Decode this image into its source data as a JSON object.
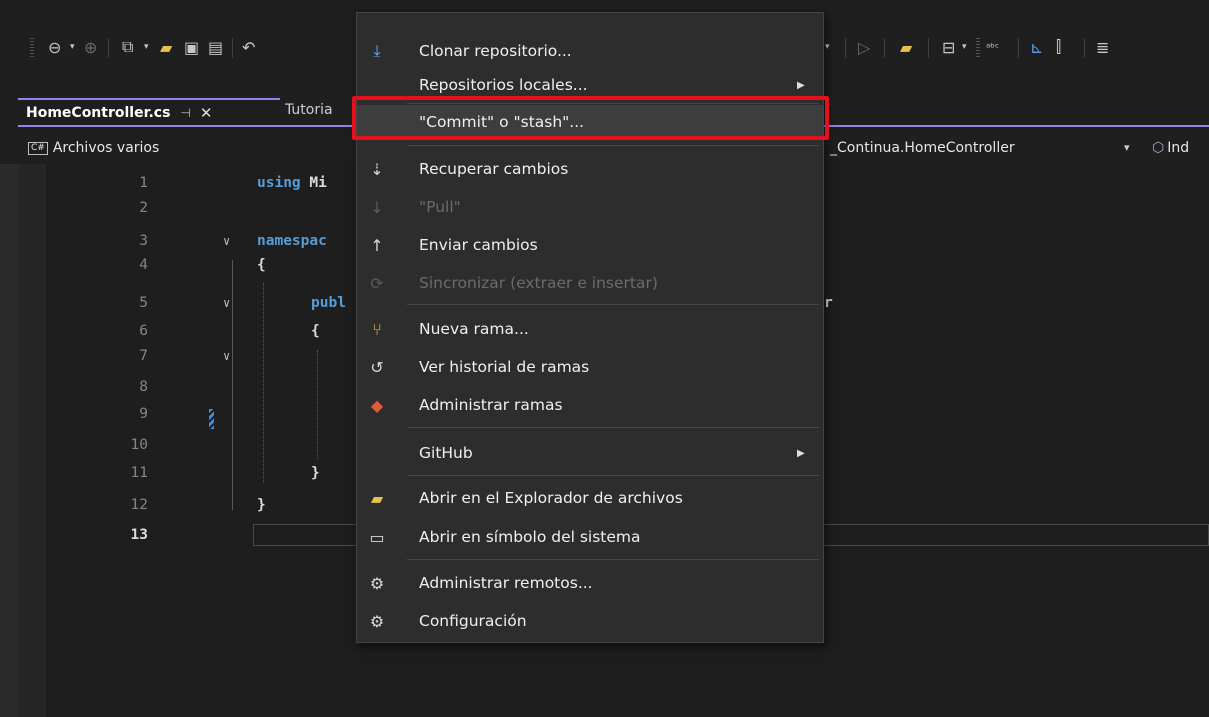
{
  "editor_tab": {
    "active_title": "HomeController.cs",
    "pin_glyph": "⊣",
    "close_glyph": "✕",
    "second_title": "Tutoria"
  },
  "navigation": {
    "left_label": "Archivos varios",
    "left_badge": "C#",
    "middle_label": "_Continua.HomeController",
    "middle_arrow": "▾",
    "right_label": "Ind"
  },
  "code": {
    "line_numbers": [
      "1",
      "2",
      "3",
      "4",
      "5",
      "6",
      "7",
      "8",
      "9",
      "10",
      "11",
      "12",
      "13"
    ],
    "current_line": "13",
    "line1_kw": "using",
    "line1_rest": " Mi",
    "line3_kw": "namespac",
    "line4": "{",
    "line5_kw": "publ",
    "line5_tail": "r",
    "line6": "{",
    "line11": "}",
    "line12": "}",
    "fold_glyph": "∨"
  },
  "context_menu": {
    "items": [
      {
        "label": "Clonar repositorio...",
        "icon": "clone-icon",
        "glyph": "⤓",
        "enabled": true,
        "submenu": false
      },
      {
        "label": "Repositorios locales...",
        "icon": "",
        "glyph": "",
        "enabled": true,
        "submenu": true
      },
      {
        "label": "\"Commit\" o \"stash\"...",
        "icon": "",
        "glyph": "",
        "enabled": true,
        "submenu": false,
        "highlighted": true
      },
      {
        "label": "Recuperar cambios",
        "icon": "fetch-icon",
        "glyph": "⇣",
        "enabled": true,
        "submenu": false
      },
      {
        "label": "\"Pull\"",
        "icon": "pull-icon",
        "glyph": "↓",
        "enabled": false,
        "submenu": false
      },
      {
        "label": "Enviar cambios",
        "icon": "push-icon",
        "glyph": "↑",
        "enabled": true,
        "submenu": false
      },
      {
        "label": "Sincronizar (extraer e insertar)",
        "icon": "sync-icon",
        "glyph": "⟳",
        "enabled": false,
        "submenu": false
      },
      {
        "label": "Nueva rama...",
        "icon": "new-branch-icon",
        "glyph": "⑂",
        "enabled": true,
        "submenu": false
      },
      {
        "label": "Ver historial de ramas",
        "icon": "history-icon",
        "glyph": "↺",
        "enabled": true,
        "submenu": false
      },
      {
        "label": "Administrar ramas",
        "icon": "manage-branches-icon",
        "glyph": "◆",
        "enabled": true,
        "submenu": false
      },
      {
        "label": "GitHub",
        "icon": "",
        "glyph": "",
        "enabled": true,
        "submenu": true
      },
      {
        "label": "Abrir en el Explorador de archivos",
        "icon": "folder-open-icon",
        "glyph": "▰",
        "enabled": true,
        "submenu": false
      },
      {
        "label": "Abrir en símbolo del sistema",
        "icon": "terminal-icon",
        "glyph": "▭",
        "enabled": true,
        "submenu": false
      },
      {
        "label": "Administrar remotos...",
        "icon": "gear-icon",
        "glyph": "⚙",
        "enabled": true,
        "submenu": false
      },
      {
        "label": "Configuración",
        "icon": "settings-icon",
        "glyph": "⚙",
        "enabled": true,
        "submenu": false
      }
    ],
    "submenu_arrow": "▶"
  },
  "colors": {
    "accent": "#9184ee",
    "highlight_border": "#e4101c",
    "keyword": "#569cd6"
  }
}
